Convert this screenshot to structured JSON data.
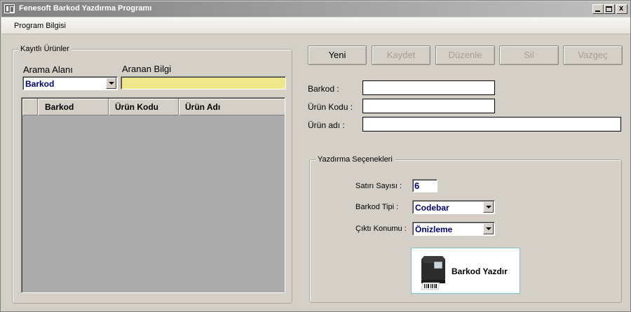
{
  "window": {
    "title": "Fenesoft Barkod Yazdırma Programı",
    "controls": {
      "minimize": "_",
      "maximize": "□",
      "close": "x"
    }
  },
  "menu": {
    "items": [
      {
        "label": "Program Bilgisi"
      }
    ]
  },
  "products_panel": {
    "legend": "Kayıtlı Ürünler",
    "search_field_label": "Arama Alanı",
    "search_field_value": "Barkod",
    "search_value_label": "Aranan Bilgi",
    "search_value": "",
    "grid": {
      "columns": [
        "Barkod",
        "Ürün Kodu",
        "Ürün Adı"
      ],
      "rows": []
    }
  },
  "toolbar": {
    "new_label": "Yeni",
    "save_label": "Kaydet",
    "edit_label": "Düzenle",
    "delete_label": "Sil",
    "cancel_label": "Vazgeç"
  },
  "form": {
    "barcode_label": "Barkod :",
    "barcode_value": "",
    "product_code_label": "Ürün Kodu :",
    "product_code_value": "",
    "product_name_label": "Ürün adı :",
    "product_name_value": ""
  },
  "print_options": {
    "legend": "Yazdırma Seçenekleri",
    "line_count_label": "Satırı Sayısı :",
    "line_count_value": "6",
    "barcode_type_label": "Barkod Tipi :",
    "barcode_type_value": "Codebar",
    "output_label": "Çıktı Konumu :",
    "output_value": "Önizleme",
    "print_button_label": "Barkod Yazdır"
  },
  "icons": {
    "app": "app-window-icon",
    "printer": "barcode-printer-icon",
    "dropdown": "chevron-down-icon"
  },
  "colors": {
    "window_bg": "#d4d0c8",
    "title_gradient_start": "#808080",
    "search_input_bg": "#f0e68c",
    "combo_text": "#00007a",
    "grid_bg": "#ababab"
  }
}
